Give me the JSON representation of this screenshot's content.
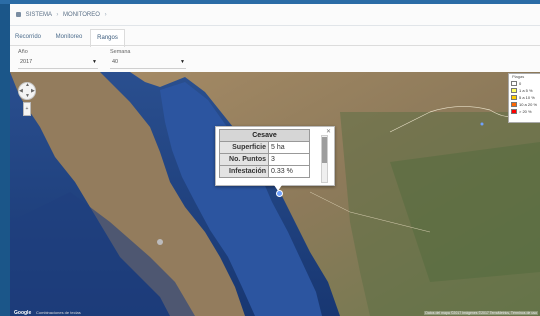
{
  "breadcrumb": {
    "items": [
      "SISTEMA",
      "MONITOREO"
    ]
  },
  "tabs": [
    {
      "label": "Recorrido"
    },
    {
      "label": "Monitoreo"
    },
    {
      "label": "Rangos"
    }
  ],
  "filters": {
    "year": {
      "label": "Año",
      "value": "2017"
    },
    "month": {
      "label": "Semana",
      "value": "40"
    }
  },
  "map": {
    "legend_title": "Plagas",
    "legend_items": [
      {
        "label": "0",
        "color": "#ffffff"
      },
      {
        "label": "1 a 5 %",
        "color": "#ffff66"
      },
      {
        "label": "5 a 10 %",
        "color": "#ffcc00"
      },
      {
        "label": "10 a 20 %",
        "color": "#ff6600"
      },
      {
        "label": "> 20 %",
        "color": "#ff0000"
      }
    ],
    "google_label": "Google",
    "attribution": "Combinaciones de teclas",
    "map_data_notice": "Datos del mapa ©2017 Imágenes ©2017 TerraMetrics, Términos de uso"
  },
  "info_window": {
    "title": "Cesave",
    "rows": [
      {
        "key": "Superficie",
        "value": "5 ha"
      },
      {
        "key": "No. Puntos",
        "value": "3"
      },
      {
        "key": "Infestación",
        "value": "0.33 %"
      }
    ]
  },
  "icons": {
    "pan_control": "pan-control-icon",
    "zoom_control": "zoom-control-icon",
    "close": "close-icon",
    "marker": "map-marker-icon"
  }
}
